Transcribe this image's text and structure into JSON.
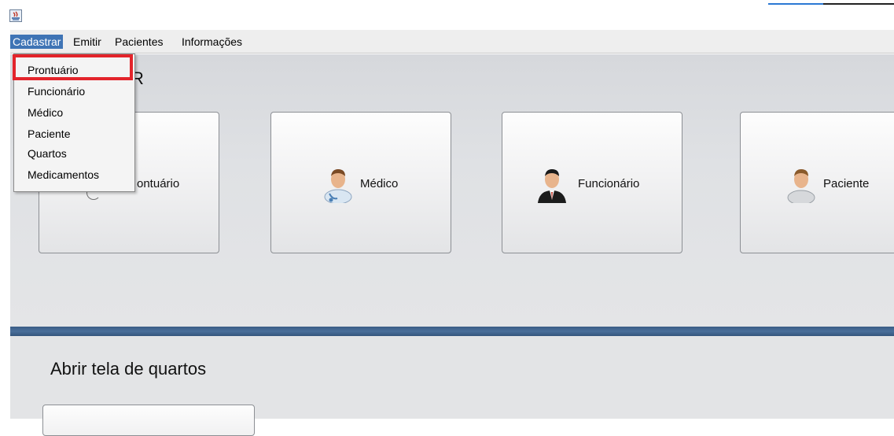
{
  "menubar": {
    "items": [
      "Cadastrar",
      "Emitir",
      "Pacientes",
      "Informações"
    ]
  },
  "cadastrar_menu": {
    "items": [
      "Prontuário",
      "Funcionário",
      "Médico",
      "Paciente",
      "Quartos",
      "Medicamentos"
    ]
  },
  "top_section": {
    "title_visible": "R",
    "buttons": [
      {
        "label_visible": "ontuário",
        "icon": "record-icon"
      },
      {
        "label": "Médico",
        "icon": "doctor-icon"
      },
      {
        "label": "Funcionário",
        "icon": "employee-icon"
      },
      {
        "label": "Paciente",
        "icon": "patient-icon"
      }
    ]
  },
  "bottom_section": {
    "title": "Abrir tela de quartos"
  },
  "colors": {
    "menu_active": "#3f74b5",
    "highlight_border": "#e3242b",
    "divider_stripe": "#3a5c86"
  }
}
